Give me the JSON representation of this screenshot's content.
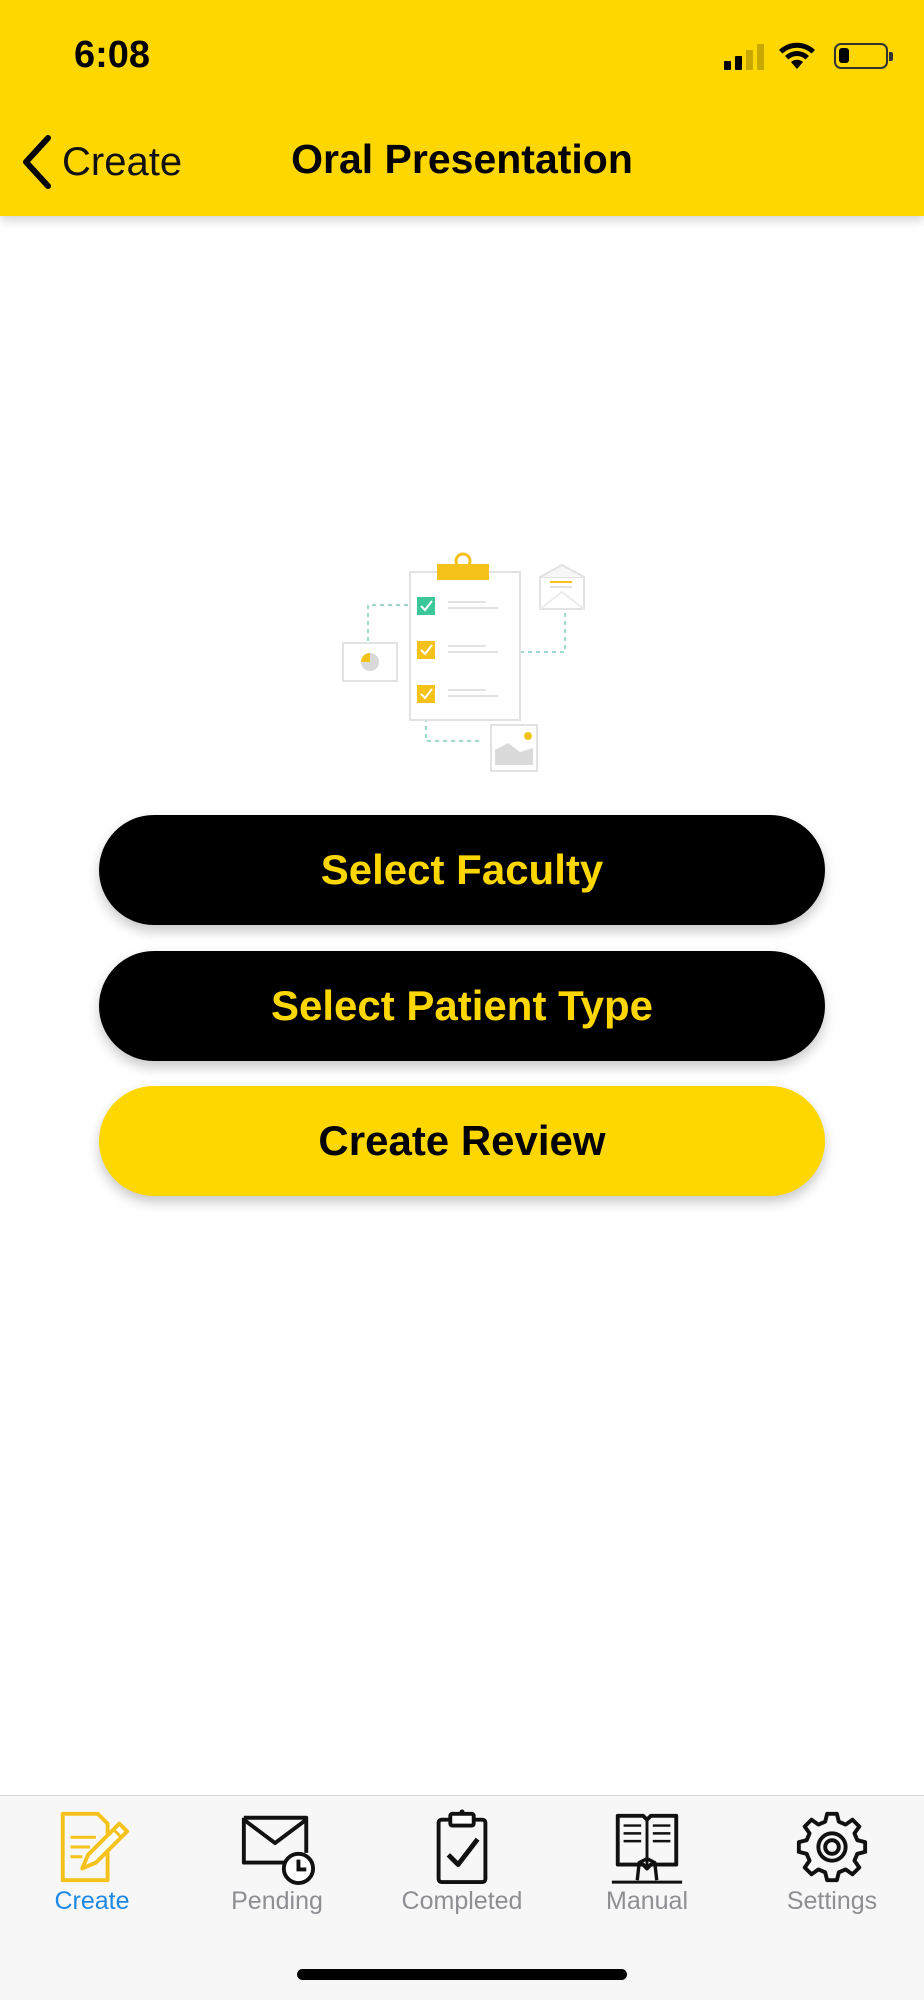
{
  "status_bar": {
    "time": "6:08"
  },
  "nav": {
    "back_label": "Create",
    "title": "Oral Presentation"
  },
  "actions": {
    "select_faculty": "Select Faculty",
    "select_patient_type": "Select Patient Type",
    "create_review": "Create Review"
  },
  "tabs": [
    {
      "label": "Create",
      "icon": "create-note-icon",
      "active": true
    },
    {
      "label": "Pending",
      "icon": "mail-clock-icon",
      "active": false
    },
    {
      "label": "Completed",
      "icon": "clipboard-check-icon",
      "active": false
    },
    {
      "label": "Manual",
      "icon": "book-icon",
      "active": false
    },
    {
      "label": "Settings",
      "icon": "gear-icon",
      "active": false
    }
  ],
  "colors": {
    "brand_yellow": "#FFD700",
    "active_tab": "#1E88E5",
    "inactive_tab": "#8E8E93",
    "dark_button": "#000000"
  }
}
